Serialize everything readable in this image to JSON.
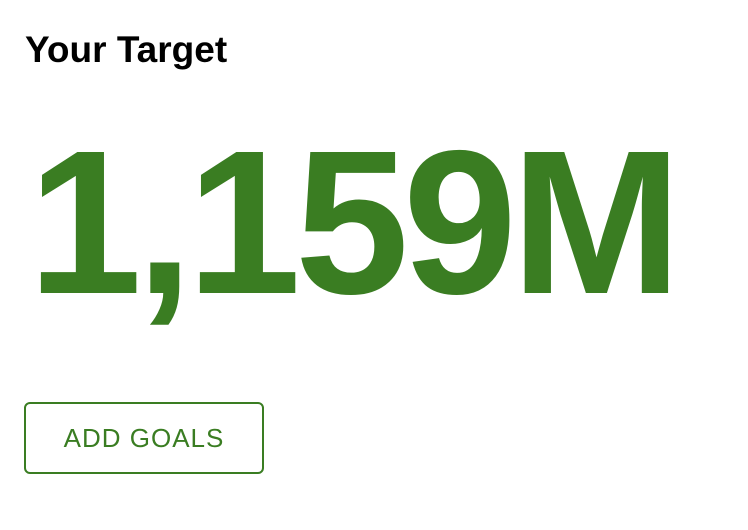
{
  "card": {
    "title": "Your Target",
    "target_value": "1,159M",
    "add_goals_label": "ADD GOALS"
  },
  "colors": {
    "accent": "#3a7d22",
    "title": "#000000",
    "background": "#ffffff"
  }
}
